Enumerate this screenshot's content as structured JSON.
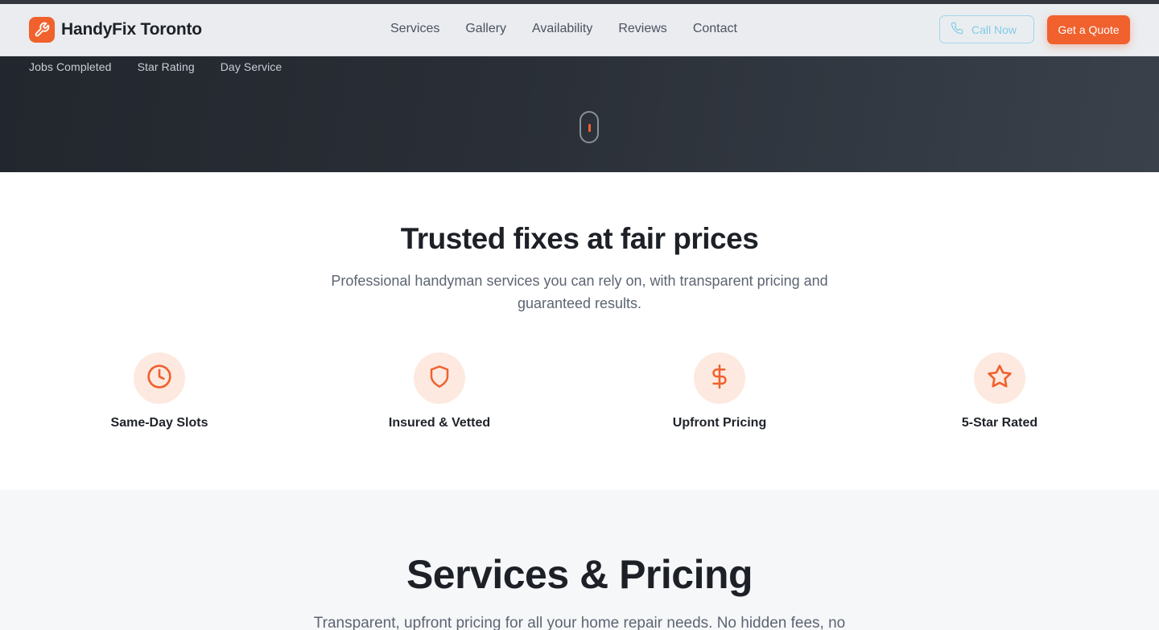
{
  "brand": {
    "name": "HandyFix Toronto",
    "logo_icon": "wrench-icon",
    "accent_color": "#f0612e"
  },
  "nav": {
    "links": [
      "Services",
      "Gallery",
      "Availability",
      "Reviews",
      "Contact"
    ],
    "call_label": "Call Now",
    "quote_label": "Get a Quote"
  },
  "hero": {
    "stats": [
      "Jobs Completed",
      "Star Rating",
      "Day Service"
    ],
    "scroll_indicator_icon": "mouse-scroll-icon"
  },
  "features": {
    "title": "Trusted fixes at fair prices",
    "subtitle": "Professional handyman services you can rely on, with transparent pricing and guaranteed results.",
    "items": [
      {
        "label": "Same-Day Slots",
        "icon": "clock-icon"
      },
      {
        "label": "Insured & Vetted",
        "icon": "shield-icon"
      },
      {
        "label": "Upfront Pricing",
        "icon": "dollar-icon"
      },
      {
        "label": "5-Star Rated",
        "icon": "star-icon"
      }
    ]
  },
  "services": {
    "title": "Services & Pricing",
    "subtitle": "Transparent, upfront pricing for all your home repair needs. No hidden fees, no"
  }
}
